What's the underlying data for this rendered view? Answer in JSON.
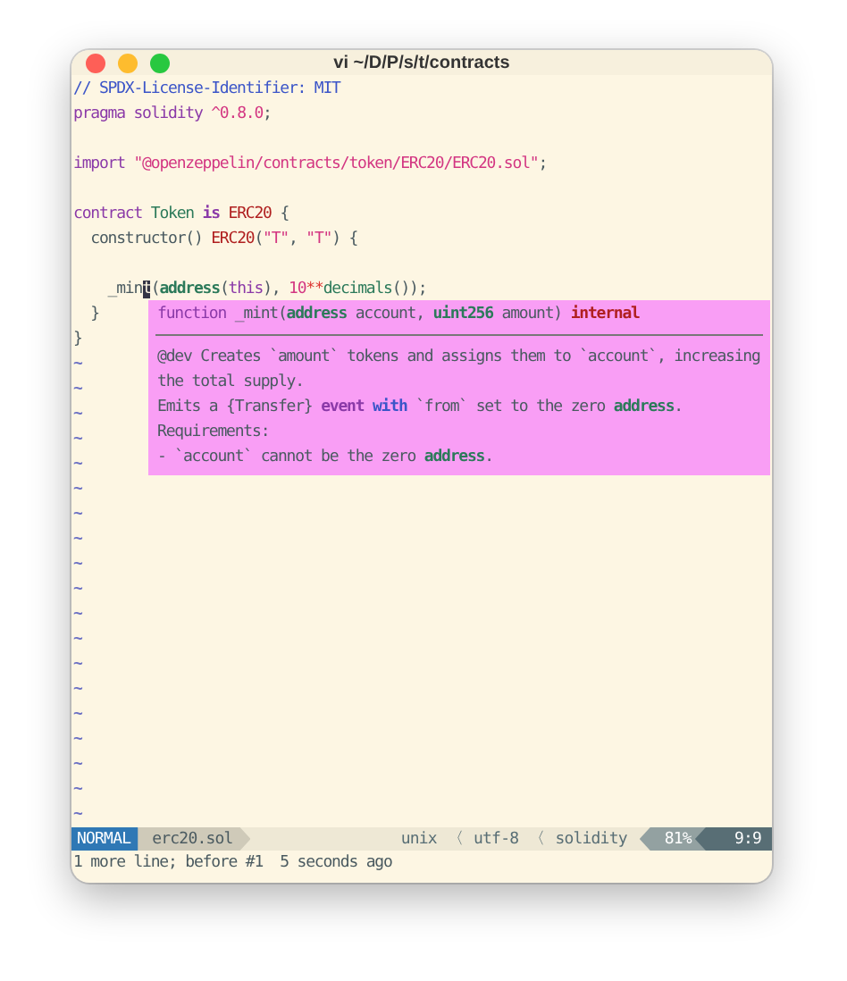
{
  "window": {
    "title": "vi ~/D/P/s/t/contracts"
  },
  "lines": [
    {
      "segments": [
        {
          "text": "// SPDX-License-Identifier: MIT",
          "kind": "comment"
        }
      ]
    },
    {
      "segments": [
        {
          "text": "pragma solidity ",
          "kind": "keyword"
        },
        {
          "text": "^0.8.0",
          "kind": "string"
        },
        {
          "text": ";",
          "kind": "plain"
        }
      ]
    },
    {
      "kind": "blank"
    },
    {
      "segments": [
        {
          "text": "import ",
          "kind": "keyword"
        },
        {
          "text": "\"@openzeppelin/contracts/token/ERC20/ERC20.sol\"",
          "kind": "string"
        },
        {
          "text": ";",
          "kind": "plain"
        }
      ]
    },
    {
      "kind": "blank"
    },
    {
      "segments": [
        {
          "text": "contract ",
          "kind": "keyword"
        },
        {
          "text": "Token ",
          "kind": "type"
        },
        {
          "text": "is ",
          "kind": "bold-keyword"
        },
        {
          "text": "ERC20 ",
          "kind": "name"
        },
        {
          "text": "{",
          "kind": "plain"
        }
      ]
    },
    {
      "segments": [
        {
          "text": "  constructor() ",
          "kind": "plain"
        },
        {
          "text": "ERC20",
          "kind": "name"
        },
        {
          "text": "(",
          "kind": "plain"
        },
        {
          "text": "\"T\"",
          "kind": "string"
        },
        {
          "text": ", ",
          "kind": "plain"
        },
        {
          "text": "\"T\"",
          "kind": "string"
        },
        {
          "text": ") {",
          "kind": "plain"
        }
      ]
    },
    {
      "kind": "blank"
    },
    {
      "segments": [
        {
          "text": "    _min",
          "kind": "plain"
        },
        {
          "text": "t",
          "kind": "cursor"
        },
        {
          "text": "(",
          "kind": "plain"
        },
        {
          "text": "address",
          "kind": "bold-type"
        },
        {
          "text": "(",
          "kind": "plain"
        },
        {
          "text": "this",
          "kind": "keyword"
        },
        {
          "text": "), ",
          "kind": "plain"
        },
        {
          "text": "10",
          "kind": "string"
        },
        {
          "text": "**",
          "kind": "operator"
        },
        {
          "text": "decimals",
          "kind": "type"
        },
        {
          "text": "());",
          "kind": "plain"
        }
      ]
    },
    {
      "segments": [
        {
          "text": "  }",
          "kind": "plain"
        }
      ]
    },
    {
      "segments": [
        {
          "text": "}",
          "kind": "plain"
        }
      ]
    }
  ],
  "empty_line_markers": [
    "~",
    "~",
    "~",
    "~",
    "~",
    "~",
    "~",
    "~",
    "~",
    "~",
    "~",
    "~",
    "~",
    "~",
    "~",
    "~",
    "~",
    "~",
    "~"
  ],
  "popup": {
    "signature": [
      {
        "text": "function ",
        "kind": "keyword"
      },
      {
        "text": "_mint(",
        "kind": "plain"
      },
      {
        "text": "address",
        "kind": "bold-type"
      },
      {
        "text": " account, ",
        "kind": "plain"
      },
      {
        "text": "uint256",
        "kind": "bold-type"
      },
      {
        "text": " amount) ",
        "kind": "plain"
      },
      {
        "text": "internal",
        "kind": "bold-name"
      }
    ],
    "doc": [
      {
        "segments": [
          {
            "text": "@dev Creates `amount` tokens and assigns them to `account`, increasing",
            "kind": "plain"
          }
        ]
      },
      {
        "segments": [
          {
            "text": "the total supply.",
            "kind": "plain"
          }
        ]
      },
      {
        "segments": [
          {
            "text": "Emits a {Transfer} ",
            "kind": "plain"
          },
          {
            "text": "event ",
            "kind": "bold-keyword"
          },
          {
            "text": "with",
            "kind": "bold-blue"
          },
          {
            "text": " `from` set to the zero ",
            "kind": "plain"
          },
          {
            "text": "address",
            "kind": "bold-type"
          },
          {
            "text": ".",
            "kind": "plain"
          }
        ]
      },
      {
        "segments": [
          {
            "text": "Requirements:",
            "kind": "plain"
          }
        ]
      },
      {
        "segments": [
          {
            "text": "- `account` cannot be the zero ",
            "kind": "plain"
          },
          {
            "text": "address",
            "kind": "bold-type"
          },
          {
            "text": ".",
            "kind": "plain"
          }
        ]
      }
    ]
  },
  "status_bar": {
    "mode": "NORMAL",
    "file": "erc20.sol",
    "format": "unix",
    "sep1": "〈",
    "encoding": "utf-8",
    "sep2": "〈",
    "filetype": "solidity",
    "percent": "81%",
    "position": "9:9"
  },
  "message": "1 more line; before #1  5 seconds ago"
}
